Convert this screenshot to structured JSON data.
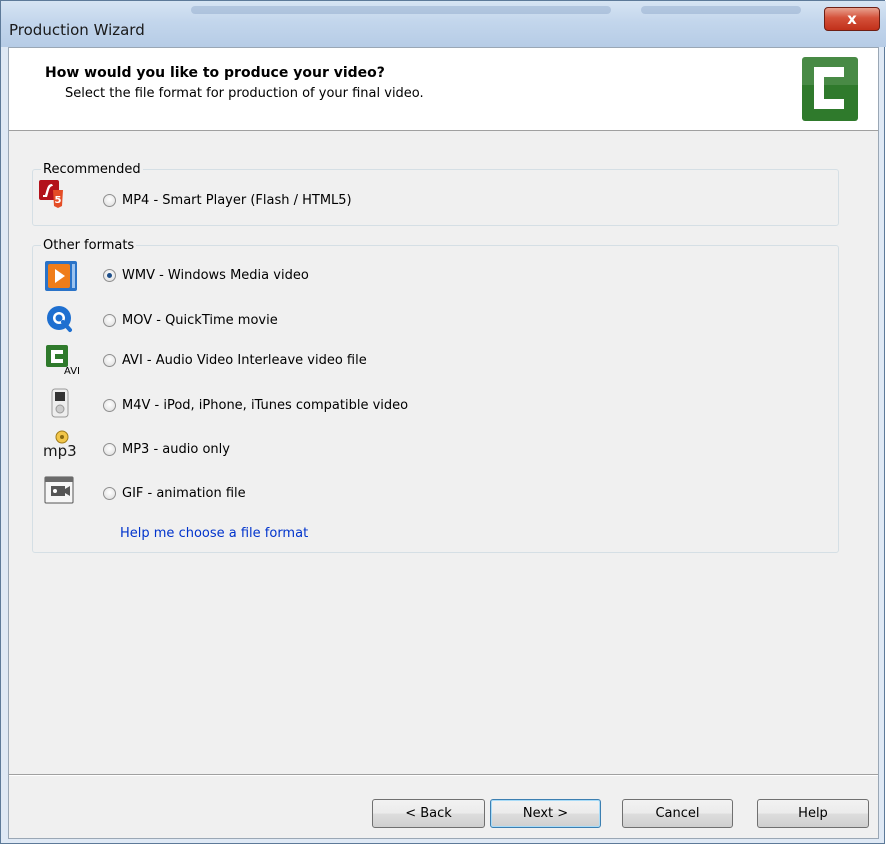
{
  "window": {
    "title": "Production Wizard",
    "close_glyph": "x"
  },
  "header": {
    "title": "How would you like to produce your video?",
    "subtitle": "Select the file format for production of your final video.",
    "logo_icon": "camtasia-logo-icon"
  },
  "recommended": {
    "legend": "Recommended",
    "options": [
      {
        "label": "MP4 - Smart Player (Flash / HTML5)",
        "icon": "flash-html5-icon",
        "selected": false
      }
    ]
  },
  "other": {
    "legend": "Other formats",
    "options": [
      {
        "label": "WMV - Windows Media video",
        "icon": "windows-media-icon",
        "selected": true
      },
      {
        "label": "MOV - QuickTime movie",
        "icon": "quicktime-icon",
        "selected": false
      },
      {
        "label": "AVI - Audio Video Interleave video file",
        "icon": "avi-icon",
        "selected": false
      },
      {
        "label": "M4V - iPod, iPhone, iTunes compatible video",
        "icon": "ipod-icon",
        "selected": false
      },
      {
        "label": "MP3 - audio only",
        "icon": "mp3-icon",
        "selected": false
      },
      {
        "label": "GIF - animation file",
        "icon": "gif-icon",
        "selected": false
      }
    ],
    "help_link": "Help me choose a file format",
    "avi_badge": "AVI",
    "mp3_badge": "mp3"
  },
  "buttons": {
    "back": "< Back",
    "next": "Next >",
    "cancel": "Cancel",
    "help": "Help"
  },
  "colors": {
    "link": "#0033cc",
    "radio_dot": "#1e4f8a",
    "logo_green": "#2f7a2c"
  }
}
